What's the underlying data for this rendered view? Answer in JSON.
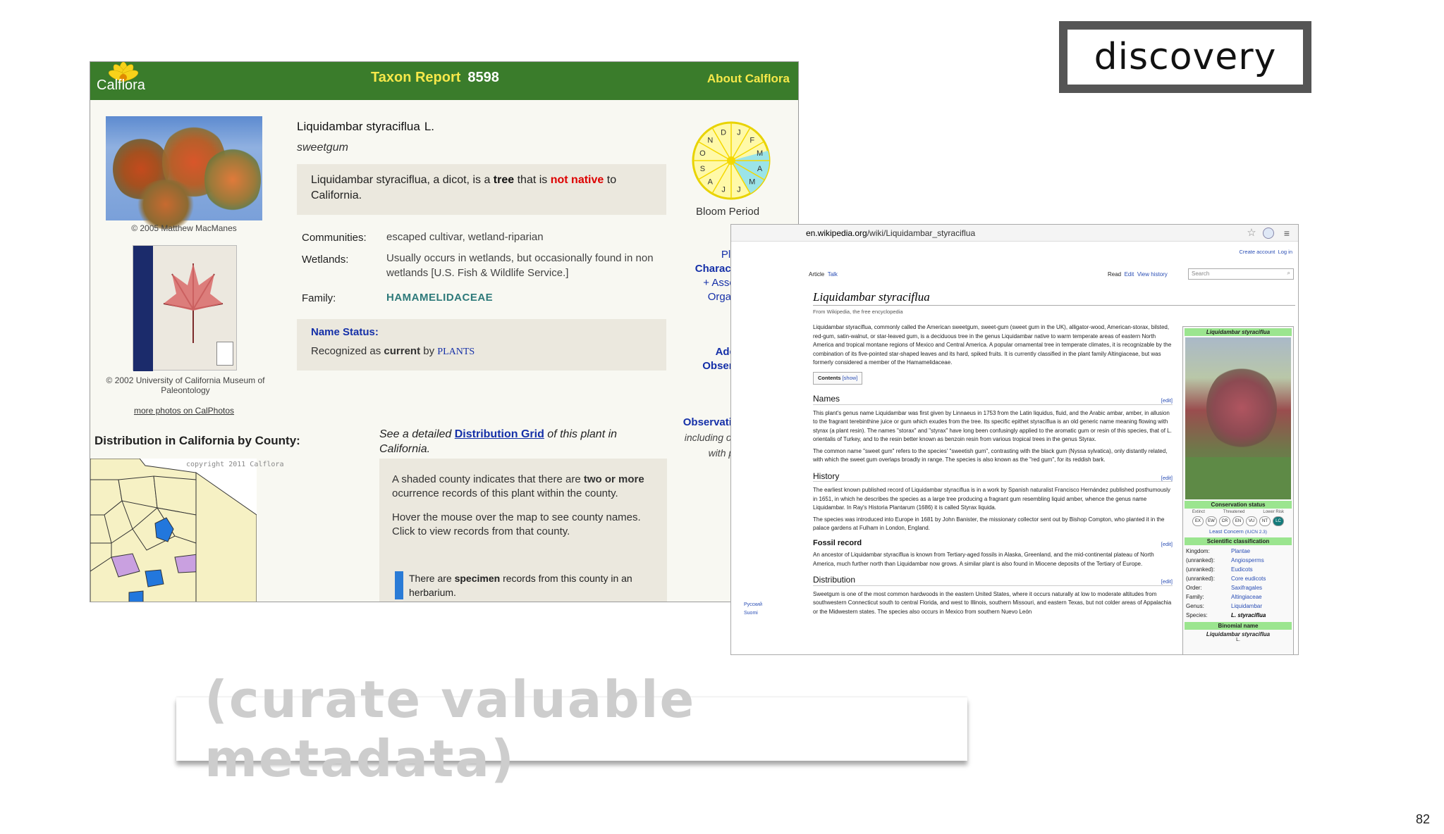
{
  "slide": {
    "discovery_label": "discovery",
    "curate_label": "(curate valuable metadata)",
    "page_number": "82"
  },
  "calflora": {
    "logo": "Calflora",
    "title": "Taxon Report",
    "report_number": "8598",
    "about": "About Calflora",
    "photo1_credit": "© 2005 Matthew MacManes",
    "photo2_credit": "© 2002 University of California Museum of Paleontology",
    "more_photos": "more photos on CalPhotos",
    "species": "Liquidambar styraciflua",
    "author": "L.",
    "common_name": "sweetgum",
    "desc": {
      "p1": "Liquidambar styraciflua, a dicot, is a ",
      "tree": "tree",
      "p2": " that is ",
      "native": "not native",
      "p3": " to California."
    },
    "communities_label": "Communities:",
    "communities_value": "escaped cultivar, wetland-riparian",
    "wetlands_label": "Wetlands:",
    "wetlands_value": "Usually occurs in wetlands, but occasionally found in non wetlands [U.S. Fish & Wildlife Service.]",
    "family_label": "Family:",
    "family_value": "HAMAMELIDACEAE",
    "name_status_label": "Name Status:",
    "name_status_pre": "Recognized as ",
    "name_status_current": "current",
    "name_status_by": " by ",
    "name_status_src": "PLANTS",
    "bloom_months": [
      "J",
      "F",
      "M",
      "A",
      "M",
      "J",
      "J",
      "A",
      "S",
      "O",
      "N",
      "D"
    ],
    "bloom_label": "Bloom Period",
    "plant_char_1": "Plant",
    "plant_char_2": "Characteristics",
    "plant_char_3": "+ Associated",
    "plant_char_4": "Organisms",
    "add_obs_1": "Add an",
    "add_obs_2": "Observation",
    "hotline_1": "Observation Hotline",
    "hotline_2": "including observations",
    "hotline_3": "with photos",
    "dist_title": "Distribution in California by County:",
    "map_copy": "copyright 2011 Calflora",
    "detail_pre": "See a detailed ",
    "detail_link": "Distribution Grid",
    "detail_post": " of this plant in California.",
    "shade_pre": "A shaded county indicates that there are ",
    "shade_bold": "two or more",
    "shade_post": " ocurrence records of this plant within the county.",
    "hover_text": "Hover the mouse over the map to see county names. Click to view records from that county.",
    "specimen_pre": "There are ",
    "specimen_bold": "specimen",
    "specimen_post": " records from this county in an herbarium."
  },
  "wiki": {
    "url_domain": "en.wikipedia.org",
    "url_path": "/wiki/Liquidambar_styraciflua",
    "create_account": "Create account",
    "log_in": "Log in",
    "tab_article": "Article",
    "tab_talk": "Talk",
    "tab_read": "Read",
    "tab_edit": "Edit",
    "tab_history": "View history",
    "search_placeholder": "Search",
    "title": "Liquidambar styraciflua",
    "from": "From Wikipedia, the free encyclopedia",
    "intro": "Liquidambar styraciflua, commonly called the American sweetgum, sweet-gum (sweet gum in the UK), alligator-wood, American-storax, bilsted, red-gum, satin-walnut, or star-leaved gum, is a deciduous tree in the genus Liquidambar native to warm temperate areas of eastern North America and tropical montane regions of Mexico and Central America. A popular ornamental tree in temperate climates, it is recognizable by the combination of its five-pointed star-shaped leaves and its hard, spiked fruits. It is currently classified in the plant family Altingiaceae, but was formerly considered a member of the Hamamelidaceae.",
    "contents": "Contents",
    "show": "[show]",
    "h_names": "Names",
    "names_p1": "This plant's genus name Liquidambar was first given by Linnaeus in 1753 from the Latin liquidus, fluid, and the Arabic ambar, amber, in allusion to the fragrant terebinthine juice or gum which exudes from the tree. Its specific epithet styraciflua is an old generic name meaning flowing with styrax (a plant resin). The names \"storax\" and \"styrax\" have long been confusingly applied to the aromatic gum or resin of this species, that of L. orientalis of Turkey, and to the resin better known as benzoin resin from various tropical trees in the genus Styrax.",
    "names_p2": "The common name \"sweet gum\" refers to the species' \"sweetish gum\", contrasting with the black gum (Nyssa sylvatica), only distantly related, with which the sweet gum overlaps broadly in range. The species is also known as the \"red gum\", for its reddish bark.",
    "h_history": "History",
    "history_p1": "The earliest known published record of Liquidambar styraciflua is in a work by Spanish naturalist Francisco Hernández published posthumously in 1651, in which he describes the species as a large tree producing a fragrant gum resembling liquid amber, whence the genus name Liquidambar. In Ray's Historia Plantarum (1686) it is called Styrax liquida.",
    "history_p2": "The species was introduced into Europe in 1681 by John Banister, the missionary collector sent out by Bishop Compton, who planted it in the palace gardens at Fulham in London, England.",
    "h_fossil": "Fossil record",
    "fossil_p": "An ancestor of Liquidambar styraciflua is known from Tertiary-aged fossils in Alaska, Greenland, and the mid-continental plateau of North America, much further north than Liquidambar now grows. A similar plant is also found in Miocene deposits of the Tertiary of Europe.",
    "h_distribution": "Distribution",
    "dist_p": "Sweetgum is one of the most common hardwoods in the eastern United States, where it occurs naturally at low to moderate altitudes from southwestern Connecticut south to central Florida, and west to Illinois, southern Missouri, and eastern Texas, but not colder areas of Appalachia or the Midwestern states. The species also occurs in Mexico from southern Nuevo León",
    "edit": "[edit]",
    "lang1": "Русский",
    "lang2": "Suomi",
    "ib_title": "Liquidambar styraciflua",
    "ib_cons": "Conservation status",
    "ib_extinct": "Extinct",
    "ib_threatened": "Threatened",
    "ib_lowrisk": "Lower Risk",
    "ib_codes": [
      "EX",
      "EW",
      "CR",
      "EN",
      "VU",
      "NT",
      "LC"
    ],
    "ib_lc": "Least Concern",
    "ib_iucn": "(IUCN 2.3)",
    "ib_sci": "Scientific classification",
    "ib_rows": [
      [
        "Kingdom:",
        "Plantae"
      ],
      [
        "(unranked):",
        "Angiosperms"
      ],
      [
        "(unranked):",
        "Eudicots"
      ],
      [
        "(unranked):",
        "Core eudicots"
      ],
      [
        "Order:",
        "Saxifragales"
      ],
      [
        "Family:",
        "Altingiaceae"
      ],
      [
        "Genus:",
        "Liquidambar"
      ],
      [
        "Species:",
        "L. styraciflua"
      ]
    ],
    "ib_binomial": "Binomial name",
    "ib_binomial_value": "Liquidambar styraciflua",
    "ib_author": "L."
  }
}
